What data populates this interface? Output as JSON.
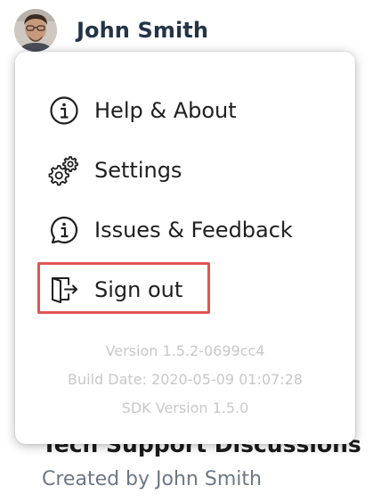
{
  "user": {
    "name": "John Smith",
    "avatar_icon": "avatar-photo"
  },
  "menu": {
    "items": [
      {
        "label": "Help & About",
        "icon": "info-icon"
      },
      {
        "label": "Settings",
        "icon": "gears-icon"
      },
      {
        "label": "Issues & Feedback",
        "icon": "feedback-icon"
      },
      {
        "label": "Sign out",
        "icon": "sign-out-icon"
      }
    ],
    "highlight_color": "#e05556"
  },
  "version_info": {
    "version": "Version 1.5.2-0699cc4",
    "build_date": "Build Date: 2020-05-09 01:07:28",
    "sdk_version": "SDK Version 1.5.0"
  },
  "background_page": {
    "title": "Tech Support Discussions",
    "subtitle": "Created by John Smith"
  }
}
